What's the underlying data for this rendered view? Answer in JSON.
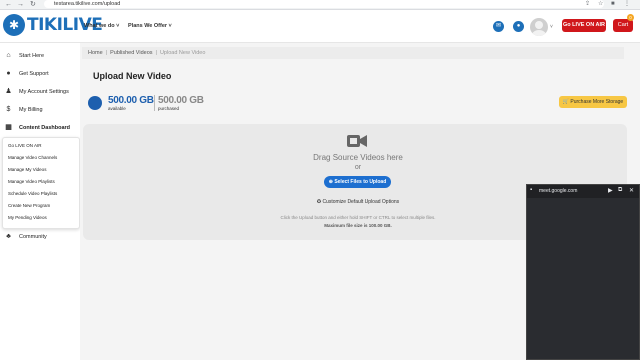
{
  "browser": {
    "back": "←",
    "forward": "→",
    "reload": "↻",
    "url": "testarea.tikilive.com/upload"
  },
  "header": {
    "logo_text": "TIKILIVE",
    "nav": [
      "What we do",
      "Plans We Offer"
    ],
    "go_live_label": "Go LIVE ON AIR",
    "cart_label": "Cart",
    "cart_count": "0"
  },
  "sidebar": {
    "items": [
      {
        "label": "Start Here",
        "icon": "home-icon"
      },
      {
        "label": "Get Support",
        "icon": "support-icon"
      },
      {
        "label": "My Account Settings",
        "icon": "user-icon"
      },
      {
        "label": "My Billing",
        "icon": "dollar-icon"
      },
      {
        "label": "Content Dashboard",
        "icon": "dashboard-icon"
      },
      {
        "label": "Community",
        "icon": "community-icon"
      }
    ],
    "submenu": [
      "Go LIVE ON AIR",
      "Manage Video Channels",
      "Manage My Videos",
      "Manage Video Playlists",
      "Schedule Video Playlists",
      "Create New Program",
      "My Pending Videos"
    ]
  },
  "breadcrumb": [
    "Home",
    "Published Videos",
    "Upload New Video"
  ],
  "page": {
    "title": "Upload New Video"
  },
  "storage": {
    "available_value": "500.00 GB",
    "available_label": "available",
    "purchased_value": "500.00 GB",
    "purchased_label": "purchased",
    "buy_label": "Purchase More Storage"
  },
  "upload": {
    "drag_text": "Drag Source Videos here",
    "or_text": "or",
    "select_label": "Select Files to Upload",
    "customize_label": "Customize Default Upload Options",
    "hint": "Click the Upload button and either hold SHIFT or CTRL to select multiple files.",
    "max_size": "Maximum file size is 100.00 GB."
  },
  "meet_popup": {
    "url": "meet.google.com"
  },
  "colors": {
    "brand": "#1d6fb8",
    "live_red": "#d0171b",
    "purchase_yellow": "#f7c744",
    "select_blue": "#1d6fd0"
  }
}
